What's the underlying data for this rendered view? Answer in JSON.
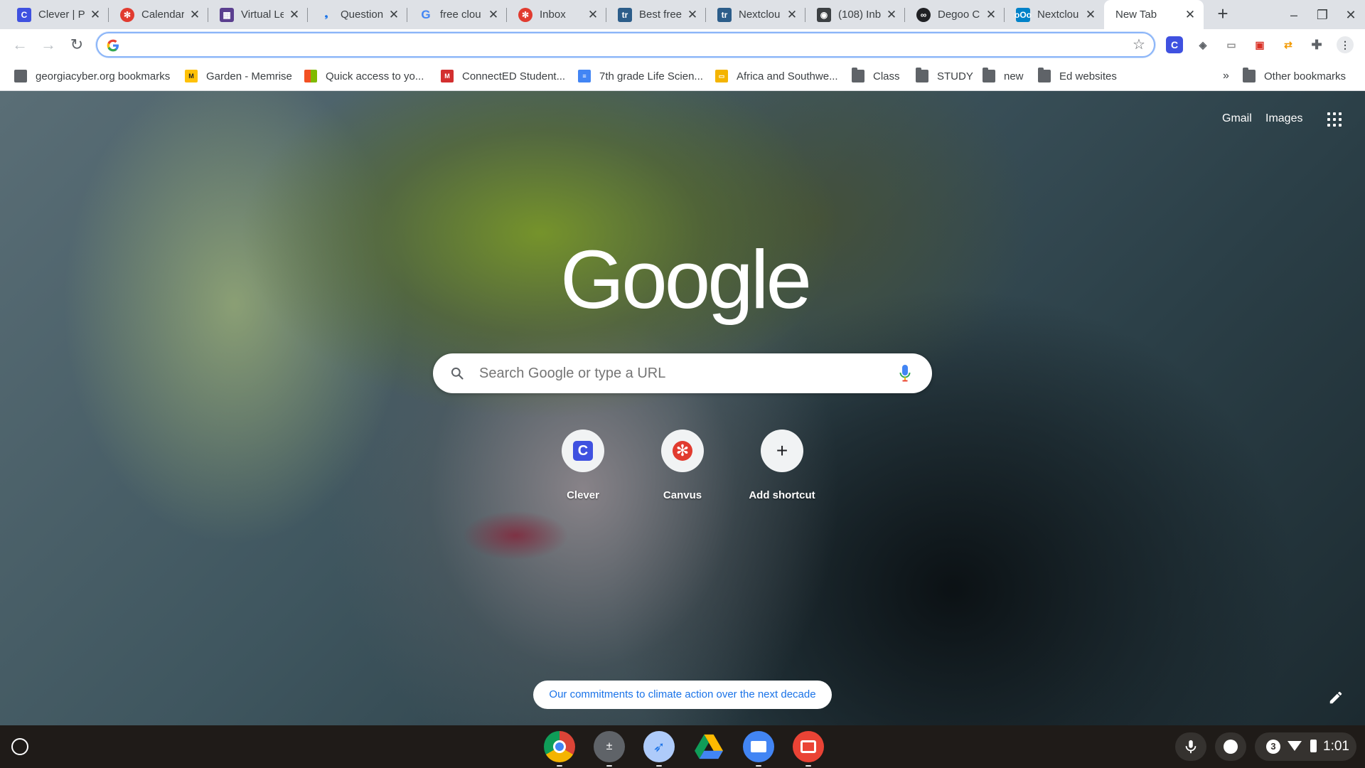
{
  "tabs": [
    {
      "title": "Clever | P",
      "icon": "clever-icon"
    },
    {
      "title": "Calendar",
      "icon": "canvas-icon"
    },
    {
      "title": "Virtual Le",
      "icon": "virtual-learning-icon"
    },
    {
      "title": "Question",
      "icon": "question-icon"
    },
    {
      "title": "free clou",
      "icon": "google-icon"
    },
    {
      "title": "Inbox",
      "icon": "canvas-icon"
    },
    {
      "title": "Best free",
      "icon": "tr-icon"
    },
    {
      "title": "Nextclou",
      "icon": "tr-icon"
    },
    {
      "title": "(108) Inb",
      "icon": "proton-icon"
    },
    {
      "title": "Degoo Cl",
      "icon": "degoo-icon"
    },
    {
      "title": "Nextclou",
      "icon": "nextcloud-icon"
    },
    {
      "title": "New Tab",
      "icon": "none"
    }
  ],
  "omnibox": {
    "value": "",
    "placeholder": ""
  },
  "bookmarks": [
    {
      "label": "georgiacyber.org bookmarks",
      "icon": "bookmarks-folder-icon"
    },
    {
      "label": "Garden - Memrise",
      "icon": "memrise-icon"
    },
    {
      "label": "Quick access to yo...",
      "icon": "microsoft-icon"
    },
    {
      "label": "ConnectED Student...",
      "icon": "mcgraw-hill-icon"
    },
    {
      "label": "7th grade Life Scien...",
      "icon": "google-docs-icon"
    },
    {
      "label": "Africa and Southwe...",
      "icon": "google-slides-icon"
    },
    {
      "label": "Class",
      "icon": "folder-icon"
    },
    {
      "label": "STUDY",
      "icon": "folder-icon"
    },
    {
      "label": "new",
      "icon": "folder-icon"
    },
    {
      "label": "Ed websites",
      "icon": "folder-icon"
    }
  ],
  "bookmarks_overflow": "»",
  "other_bookmarks": "Other bookmarks",
  "ntp": {
    "gmail": "Gmail",
    "images": "Images",
    "logo_text": "Google",
    "search_placeholder": "Search Google or type a URL",
    "shortcuts": [
      {
        "label": "Clever"
      },
      {
        "label": "Canvus"
      },
      {
        "label": "Add shortcut"
      }
    ],
    "climate_link": "Our commitments to climate action over the next decade"
  },
  "shelf": {
    "apps": [
      "chrome-icon",
      "calculator-icon",
      "rocket-app-icon",
      "google-drive-icon",
      "files-icon",
      "screencast-icon"
    ],
    "notification_count": "3",
    "clock": "1:01"
  },
  "colors": {
    "tabstrip": "#dee1e6",
    "accent": "#1a73e8",
    "shelf": "#1f1b18"
  }
}
